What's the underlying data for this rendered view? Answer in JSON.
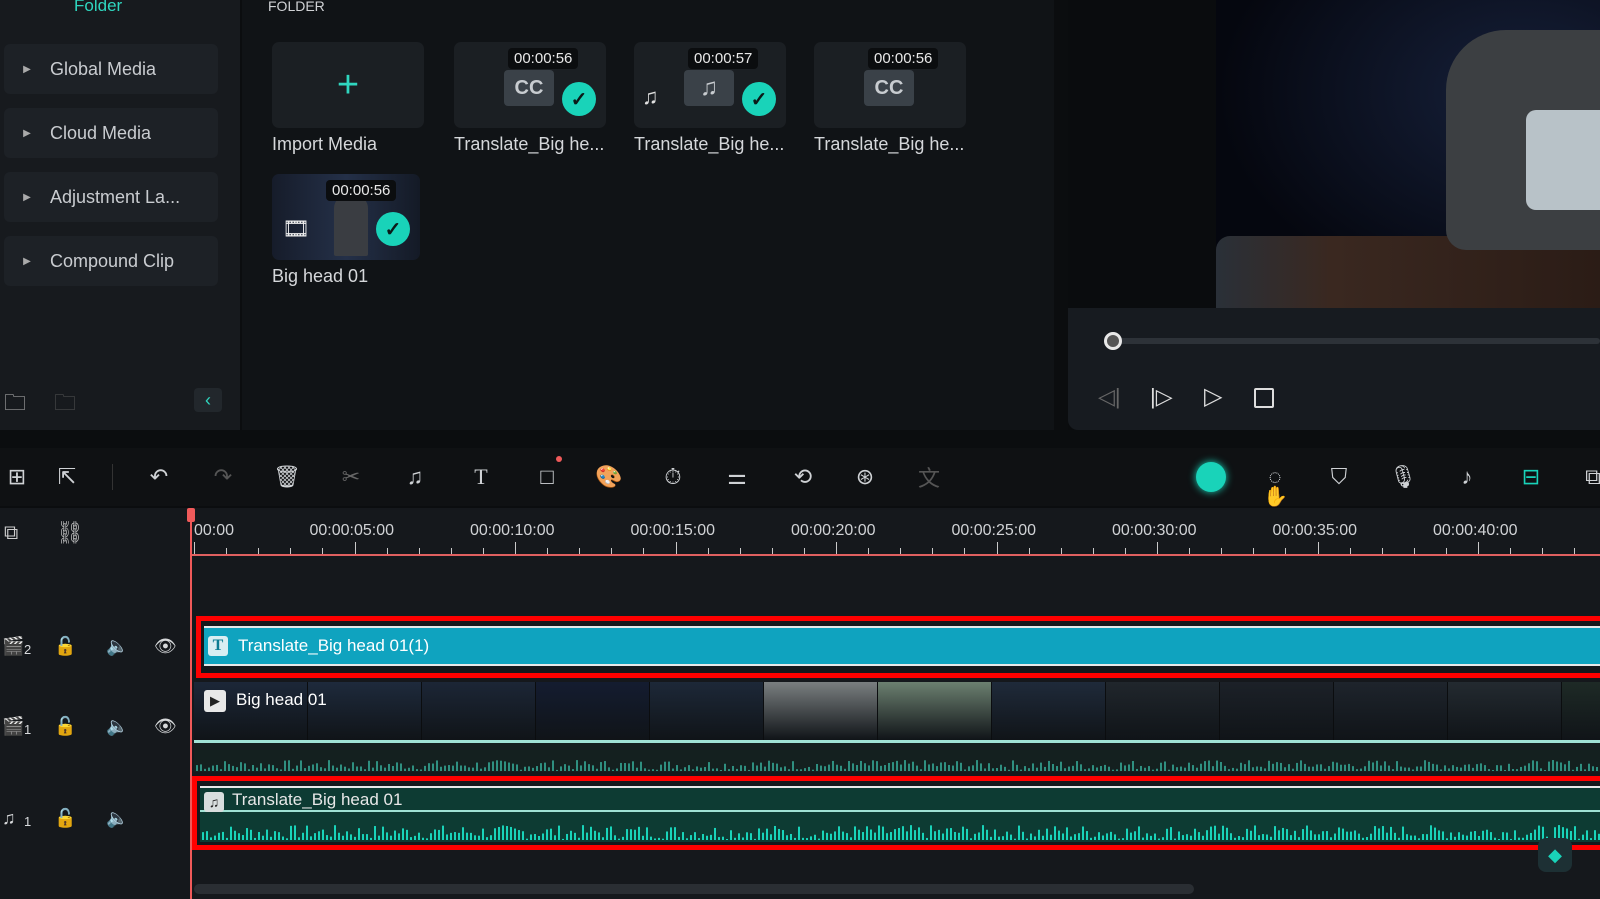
{
  "sidebar": {
    "folder_label": "Folder",
    "items": [
      {
        "label": "Global Media"
      },
      {
        "label": "Cloud Media"
      },
      {
        "label": "Adjustment La..."
      },
      {
        "label": "Compound Clip"
      }
    ]
  },
  "media": {
    "header": "FOLDER",
    "items": [
      {
        "label": "Import Media",
        "type": "import"
      },
      {
        "label": "Translate_Big he...",
        "duration": "00:00:56",
        "type": "subtitle",
        "checked": true
      },
      {
        "label": "Translate_Big he...",
        "duration": "00:00:57",
        "type": "audio",
        "checked": true
      },
      {
        "label": "Translate_Big he...",
        "duration": "00:00:56",
        "type": "subtitle",
        "checked": false
      },
      {
        "label": "Big head 01",
        "duration": "00:00:56",
        "type": "video",
        "checked": true
      }
    ]
  },
  "player": {
    "progress": 0
  },
  "ruler": {
    "labels": [
      "00:00",
      "00:00:05:00",
      "00:00:10:00",
      "00:00:15:00",
      "00:00:20:00",
      "00:00:25:00",
      "00:00:30:00",
      "00:00:35:00",
      "00:00:40:00"
    ]
  },
  "tracks": [
    {
      "id": "V2",
      "number": "2",
      "clip": "Translate_Big head 01(1)",
      "highlighted": true
    },
    {
      "id": "V1",
      "number": "1",
      "clip": "Big head 01",
      "highlighted": false
    },
    {
      "id": "A1",
      "number": "1",
      "clip": "Translate_Big head 01",
      "highlighted": true
    }
  ],
  "colors": {
    "accent": "#19d3b9",
    "subtitle_clip": "#0fa3bf",
    "audio_clip": "#0d3b33",
    "highlight": "#ff0000",
    "playhead": "#f05a5a"
  }
}
